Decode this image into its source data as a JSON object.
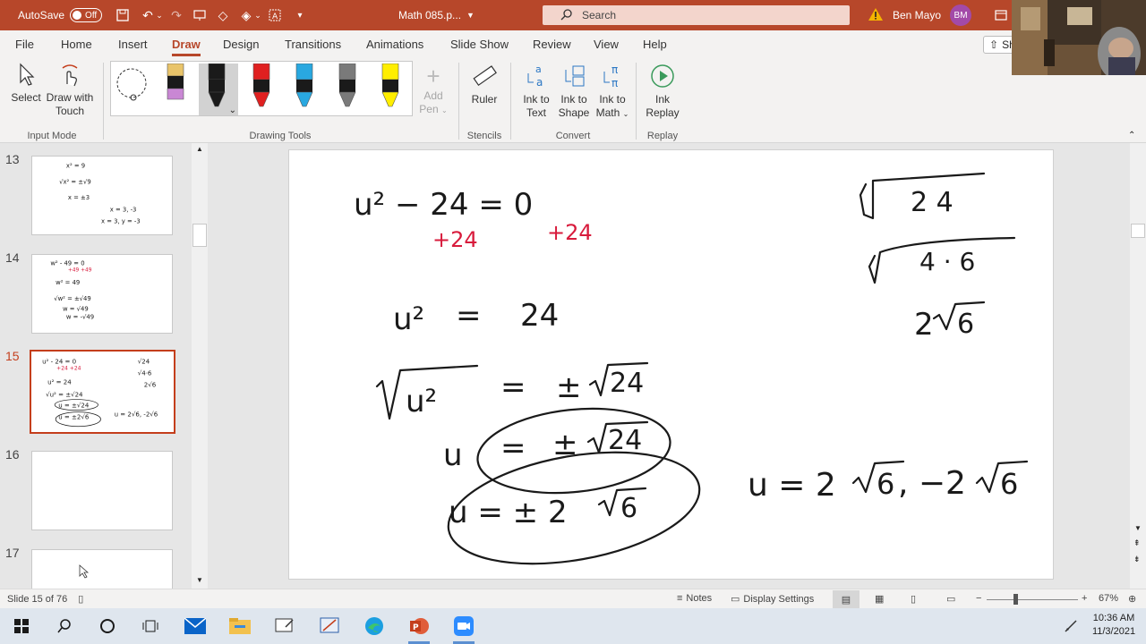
{
  "title_bar": {
    "autosave_label": "AutoSave",
    "autosave_state": "Off",
    "doc_title": "Math 085.p...",
    "search_label": "Search",
    "user_name": "Ben Mayo",
    "user_initials": "BM"
  },
  "tabs": [
    "File",
    "Home",
    "Insert",
    "Draw",
    "Design",
    "Transitions",
    "Animations",
    "Slide Show",
    "Review",
    "View",
    "Help"
  ],
  "active_tab": "Draw",
  "share_label": "Sh",
  "ribbon": {
    "select_label": "Select",
    "draw_touch_label_1": "Draw with",
    "draw_touch_label_2": "Touch",
    "input_mode_group": "Input Mode",
    "add_pen_label_1": "Add",
    "add_pen_label_2": "Pen",
    "drawing_tools_group": "Drawing Tools",
    "ruler_label": "Ruler",
    "stencils_group": "Stencils",
    "ink_to_text_1": "Ink to",
    "ink_to_text_2": "Text",
    "ink_to_shape_1": "Ink to",
    "ink_to_shape_2": "Shape",
    "ink_to_math_1": "Ink to",
    "ink_to_math_2": "Math",
    "convert_group": "Convert",
    "ink_replay_1": "Ink",
    "ink_replay_2": "Replay",
    "replay_group": "Replay",
    "pen_colors": [
      "#e9c46a",
      "#1a1a1a",
      "#e02020",
      "#29a8e0",
      "#7a7a7a",
      "#ffee00"
    ]
  },
  "thumbnails": [
    {
      "num": "13",
      "lines": [
        "x² = 9",
        "√x² = ±√9",
        "x = ±3",
        "x = 3, -3",
        "x = 3, y = -3"
      ]
    },
    {
      "num": "14",
      "lines": [
        "w² - 49 = 0",
        "+49  +49",
        "w² = 49",
        "√w² = ±√49",
        "w = √49",
        "w = -√49"
      ]
    },
    {
      "num": "15",
      "lines": [
        "u² - 24 = 0",
        "+24  +24",
        "u² = 24",
        "√u² = ±√24",
        "u = ±√24",
        "u = ±2√6",
        "u = 2√6, -2√6",
        "√24",
        "√4·6",
        "2√6"
      ]
    },
    {
      "num": "16",
      "lines": []
    },
    {
      "num": "17",
      "lines": []
    }
  ],
  "selected_slide": "15",
  "slide": {
    "line1": "u² − 24 = 0",
    "red_left": "+24",
    "red_right": "+24",
    "line2_left": "u²",
    "line2_eq": "=",
    "line2_right": "24",
    "line3_left": "u²",
    "line3_eq": "=",
    "line3_pm": "±",
    "line3_rad": "24",
    "line4_u": "u",
    "line4_eq": "=",
    "line4_pm": "±",
    "line4_rad": "24",
    "line5": "u = ± 2",
    "line5_rad": "6",
    "answer_a": "u = 2",
    "answer_b": "6",
    "answer_c": ", −2",
    "answer_d": "6",
    "side_rad1": "2 4",
    "side_rad2": "4 · 6",
    "side_res_coef": "2",
    "side_res_rad": "6"
  },
  "status_bar": {
    "slide_info": "Slide 15 of 76",
    "notes_label": "Notes",
    "display_settings_label": "Display Settings",
    "zoom": "67%"
  },
  "taskbar": {
    "time": "10:36 AM",
    "date": "11/3/2021"
  }
}
